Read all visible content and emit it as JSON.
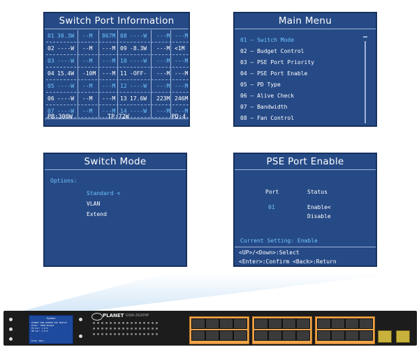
{
  "switch_port_info": {
    "title": "Switch Port Information",
    "rows": [
      {
        "p1": "01",
        "v1": "30.3W",
        "s1": "--M",
        "r1": "867M",
        "p2": "08",
        "v2": "----W",
        "s2": "---M",
        "r2": "---M",
        "c1": true,
        "c2": true
      },
      {
        "p1": "02",
        "v1": "----W",
        "s1": "--M",
        "r1": "---M",
        "p2": "09",
        "v2": "-8.3W",
        "s2": "---M",
        "r2": "<1M",
        "c1": false,
        "c2": false
      },
      {
        "p1": "03",
        "v1": "----W",
        "s1": "--M",
        "r1": "---M",
        "p2": "10",
        "v2": "----W",
        "s2": "---M",
        "r2": "---M",
        "c1": true,
        "c2": true
      },
      {
        "p1": "04",
        "v1": "15.4W",
        "s1": "-10M",
        "r1": "---M",
        "p2": "11",
        "v2": "-OFF-",
        "s2": "---M",
        "r2": "---M",
        "c1": false,
        "c2": false
      },
      {
        "p1": "05",
        "v1": "----W",
        "s1": "--M",
        "r1": "---M",
        "p2": "12",
        "v2": "----W",
        "s2": "---M",
        "r2": "---M",
        "c1": true,
        "c2": true
      },
      {
        "p1": "06",
        "v1": "----W",
        "s1": "--M",
        "r1": "---M",
        "p2": "13",
        "v2": "17.6W",
        "s2": "223M",
        "r2": "246M",
        "c1": false,
        "c2": false
      },
      {
        "p1": "07",
        "v1": "----W",
        "s1": "--M",
        "r1": "---M",
        "p2": "14",
        "v2": "----W",
        "s2": "---M",
        "r2": "---M",
        "c1": true,
        "c2": true
      }
    ],
    "footer": {
      "pb": "PB:300W",
      "tp": "TP:72W",
      "pd": "PD:4"
    }
  },
  "main_menu": {
    "title": "Main Menu",
    "items": [
      "01 –  Switch Mode",
      "02 –  Budget Control",
      "03 –  PSE Port Priority",
      "04 –  PSE Port Enable",
      "05 –  PD Type",
      "06 –  Alive Check",
      "07 –  Bandwidth",
      "08 –  Fan Control"
    ],
    "selected_index": 0
  },
  "switch_mode": {
    "title": "Switch Mode",
    "options_label": "Options:",
    "options": [
      "Standard <",
      "VLAN",
      "Extend"
    ],
    "selected_index": 0
  },
  "pse_port_enable": {
    "title": "PSE Port Enable",
    "port_header": "Port",
    "status_header": "Status",
    "port_value": "01",
    "status_options": [
      "Enable<",
      "Disable"
    ],
    "current_setting": "Current Setting: Enable",
    "help1": "<UP>/<Down>:Select",
    "help2": "<Enter>:Confirm <Back>:Return"
  },
  "device": {
    "brand": "PLANET",
    "model": "GSW-2620HP",
    "lcd_title": "System",
    "lcd_lines": [
      "PLANET GSW-2620HP PoE SWITCH",
      "Power: 300W Budget",
      "FW Ver: 1.0.0",
      "HW Ver: 1.0.0"
    ],
    "lcd_bottom": "Enter Menu"
  },
  "colors": {
    "lcd_bg": "#264a86",
    "lcd_border": "#17315e",
    "highlight": "#6ec5ff",
    "port_orange": "#eea44a"
  }
}
